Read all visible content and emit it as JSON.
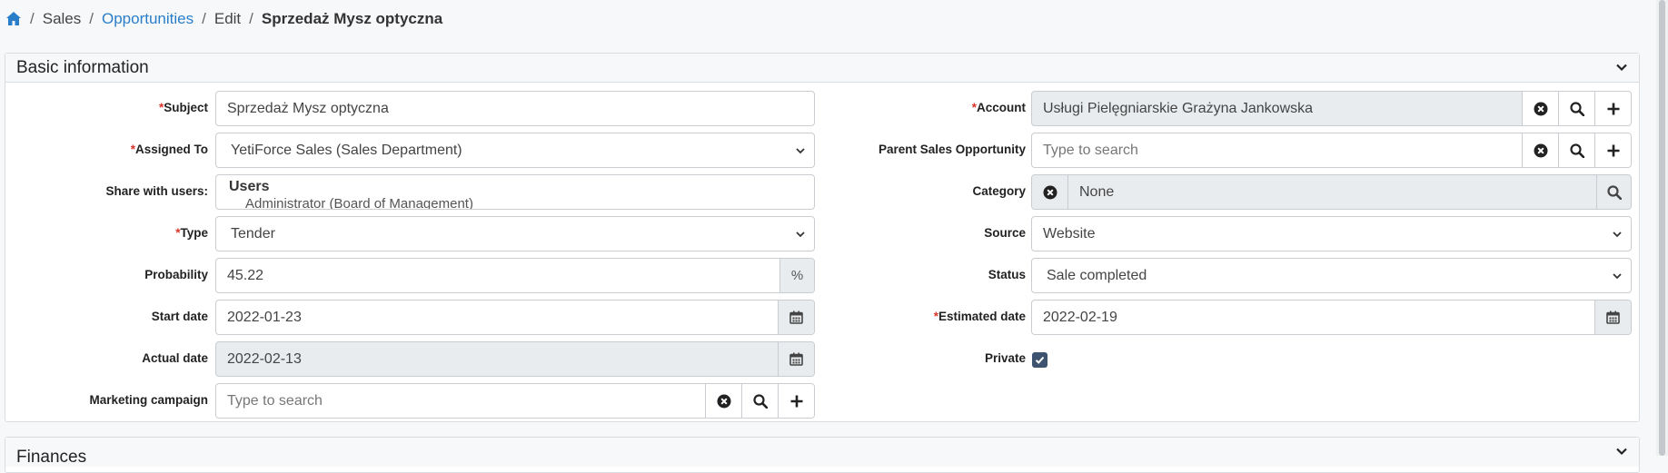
{
  "breadcrumb": {
    "items": [
      "Sales",
      "Opportunities",
      "Edit",
      "Sprzedaż Mysz optyczna"
    ]
  },
  "panels": {
    "basic": {
      "title": "Basic information"
    },
    "finances": {
      "title": "Finances"
    }
  },
  "fields": {
    "subject": {
      "label": "Subject",
      "value": "Sprzedaż Mysz optyczna"
    },
    "assigned_to": {
      "label": "Assigned To",
      "value": "YetiForce Sales (Sales Department)"
    },
    "share_with_users": {
      "label": "Share with users:",
      "group": "Users",
      "option": "Administrator (Board of Management)"
    },
    "type": {
      "label": "Type",
      "value": "Tender"
    },
    "probability": {
      "label": "Probability",
      "value": "45.22",
      "unit": "%"
    },
    "start_date": {
      "label": "Start date",
      "value": "2022-01-23"
    },
    "actual_date": {
      "label": "Actual date",
      "value": "2022-02-13"
    },
    "marketing_campaign": {
      "label": "Marketing campaign",
      "placeholder": "Type to search"
    },
    "account": {
      "label": "Account",
      "value": "Usługi Pielęgniarskie Grażyna Jankowska"
    },
    "parent_opportunity": {
      "label": "Parent Sales Opportunity",
      "placeholder": "Type to search"
    },
    "category": {
      "label": "Category",
      "value": "None"
    },
    "source": {
      "label": "Source",
      "value": "Website"
    },
    "status": {
      "label": "Status",
      "value": "Sale completed"
    },
    "estimated_date": {
      "label": "Estimated date",
      "value": "2022-02-19"
    },
    "private": {
      "label": "Private",
      "checked": true
    }
  },
  "required_marker": "*",
  "colors": {
    "link": "#2a7ec9",
    "required": "#d9342b",
    "checkbox": "#3d5370"
  }
}
